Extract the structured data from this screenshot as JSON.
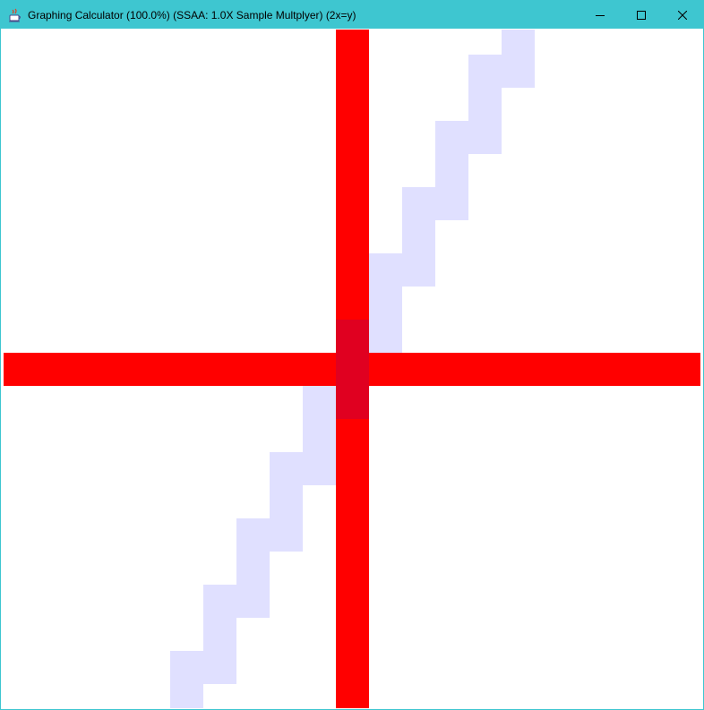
{
  "window": {
    "title": "Graphing Calculator (100.0%) (SSAA: 1.0X Sample Multplyer) (2x=y)",
    "icon": "java-coffee-cup-icon",
    "controls": [
      "minimize-icon",
      "maximize-icon",
      "close-icon"
    ],
    "titlebar_color": "#3ec6d0"
  },
  "graph": {
    "equation": "2x=y",
    "x_range": [
      -10,
      11
    ],
    "y_range": [
      -10,
      11
    ],
    "axis_color": "#ff0000",
    "plot_color": "#e0e0ff",
    "overlap_color": "#e00020",
    "plot_points": [
      {
        "x": -5,
        "y": -10
      },
      {
        "x": -5,
        "y": -9
      },
      {
        "x": -4,
        "y": -9
      },
      {
        "x": -4,
        "y": -8
      },
      {
        "x": -4,
        "y": -7
      },
      {
        "x": -3,
        "y": -7
      },
      {
        "x": -3,
        "y": -6
      },
      {
        "x": -3,
        "y": -5
      },
      {
        "x": -2,
        "y": -5
      },
      {
        "x": -2,
        "y": -4
      },
      {
        "x": -2,
        "y": -3
      },
      {
        "x": -1,
        "y": -3
      },
      {
        "x": -1,
        "y": -2
      },
      {
        "x": -1,
        "y": -1
      },
      {
        "x": 0,
        "y": -1
      },
      {
        "x": 0,
        "y": 0
      },
      {
        "x": 0,
        "y": 1
      },
      {
        "x": 1,
        "y": 1
      },
      {
        "x": 1,
        "y": 2
      },
      {
        "x": 1,
        "y": 3
      },
      {
        "x": 2,
        "y": 3
      },
      {
        "x": 2,
        "y": 4
      },
      {
        "x": 2,
        "y": 5
      },
      {
        "x": 3,
        "y": 5
      },
      {
        "x": 3,
        "y": 6
      },
      {
        "x": 3,
        "y": 7
      },
      {
        "x": 4,
        "y": 7
      },
      {
        "x": 4,
        "y": 8
      },
      {
        "x": 4,
        "y": 9
      },
      {
        "x": 5,
        "y": 9
      },
      {
        "x": 5,
        "y": 10
      }
    ]
  }
}
